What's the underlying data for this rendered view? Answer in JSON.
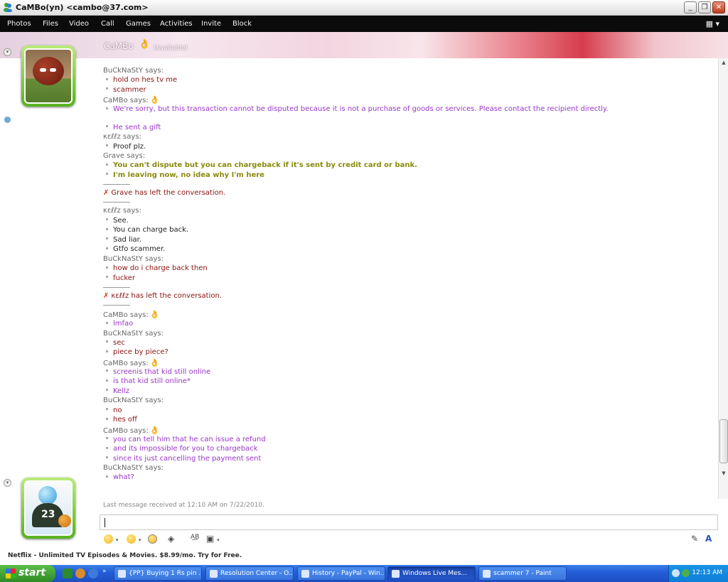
{
  "window": {
    "title": "CaMBo(yn) <cambo@37.com>"
  },
  "menu": [
    "Photos",
    "Files",
    "Video",
    "Call",
    "Games",
    "Activities",
    "Invite",
    "Block"
  ],
  "banner": {
    "name": "CaMBo",
    "status": "(Available)"
  },
  "conversation": [
    {
      "kind": "says",
      "who": "BuCkNaStY",
      "text": "BuCkNaStY says:"
    },
    {
      "kind": "msg",
      "cls": "c-buck",
      "text": "hold on hes tv me"
    },
    {
      "kind": "msg",
      "cls": "c-buck",
      "text": "scammer"
    },
    {
      "kind": "says",
      "who": "CaMBo",
      "text": "CaMBo says:",
      "hand": true
    },
    {
      "kind": "msg",
      "cls": "c-cambo",
      "text": "We're sorry, but this transaction cannot be disputed because it is not a purchase of goods or services. Please contact the recipient directly."
    },
    {
      "kind": "msg",
      "cls": "c-cambo",
      "text": "He sent a gift",
      "gap": true
    },
    {
      "kind": "says",
      "who": "κεℓℓz",
      "text": "κεℓℓz says:"
    },
    {
      "kind": "msg",
      "cls": "c-kellz",
      "text": "Proof plz."
    },
    {
      "kind": "says",
      "who": "Grave",
      "text": "Grave says:"
    },
    {
      "kind": "msg",
      "cls": "c-grave",
      "text": "You can't dispute but you can chargeback if it's sent by credit card or bank."
    },
    {
      "kind": "msg",
      "cls": "c-grave",
      "text": "I'm leaving now, no idea why I'm here"
    },
    {
      "kind": "hr"
    },
    {
      "kind": "sys",
      "text": "Grave has left the conversation."
    },
    {
      "kind": "hr"
    },
    {
      "kind": "says",
      "who": "κεℓℓz",
      "text": "κεℓℓz says:"
    },
    {
      "kind": "msg",
      "cls": "c-kellz",
      "text": "See."
    },
    {
      "kind": "msg",
      "cls": "c-kellz",
      "text": "You can charge back."
    },
    {
      "kind": "msg",
      "cls": "c-kellz",
      "text": "Sad liar."
    },
    {
      "kind": "msg",
      "cls": "c-kellz",
      "text": "Gtfo scammer."
    },
    {
      "kind": "says",
      "who": "BuCkNaStY",
      "text": "BuCkNaStY says:"
    },
    {
      "kind": "msg",
      "cls": "c-buck",
      "text": "how do i charge back then"
    },
    {
      "kind": "msg",
      "cls": "c-buck",
      "text": "fucker"
    },
    {
      "kind": "hr"
    },
    {
      "kind": "sys",
      "text": "κεℓℓz has left the conversation."
    },
    {
      "kind": "hr"
    },
    {
      "kind": "says",
      "who": "CaMBo",
      "text": "CaMBo says:",
      "hand": true
    },
    {
      "kind": "msg",
      "cls": "c-cambo",
      "text": "lmfao"
    },
    {
      "kind": "says",
      "who": "BuCkNaStY",
      "text": "BuCkNaStY says:"
    },
    {
      "kind": "msg",
      "cls": "c-buck",
      "text": "sec"
    },
    {
      "kind": "msg",
      "cls": "c-buck",
      "text": "piece by piece?"
    },
    {
      "kind": "says",
      "who": "CaMBo",
      "text": "CaMBo says:",
      "hand": true
    },
    {
      "kind": "msg",
      "cls": "c-cambo",
      "text": "screenis that kid still online"
    },
    {
      "kind": "msg",
      "cls": "c-cambo",
      "text": "is that kid still online*"
    },
    {
      "kind": "msg",
      "cls": "c-cambo",
      "text": "Kellz"
    },
    {
      "kind": "says",
      "who": "BuCkNaStY",
      "text": "BuCkNaStY says:"
    },
    {
      "kind": "msg",
      "cls": "c-buck",
      "text": "no"
    },
    {
      "kind": "msg",
      "cls": "c-buck",
      "text": "hes off"
    },
    {
      "kind": "says",
      "who": "CaMBo",
      "text": "CaMBo says:",
      "hand": true
    },
    {
      "kind": "msg",
      "cls": "c-cambo",
      "text": "you can tell him that he can issue a refund"
    },
    {
      "kind": "msg",
      "cls": "c-cambo",
      "text": "and its impossible for you to chargeback"
    },
    {
      "kind": "msg",
      "cls": "c-cambo",
      "text": "since its just cancelling the payment sent"
    },
    {
      "kind": "says",
      "who": "BuCkNaStY",
      "text": "BuCkNaStY says:"
    },
    {
      "kind": "msg",
      "cls": "c-cambo",
      "text": "what?"
    }
  ],
  "last_message": "Last message received at 12:10 AM on 7/22/2010.",
  "ad": "Netflix - Unlimited TV Episodes & Movies. $8.99/mo. Try for Free.",
  "taskbar": {
    "start": "start",
    "tasks": [
      {
        "label": "{PP} Buying 1 Rs pin ...",
        "active": false
      },
      {
        "label": "Resolution Center - O...",
        "active": false
      },
      {
        "label": "History - PayPal - Win...",
        "active": false
      },
      {
        "label": "Windows Live Mes...",
        "active": true
      },
      {
        "label": "scammer 7 - Paint",
        "active": false
      }
    ],
    "clock": "12:13 AM"
  },
  "colors": {
    "menubar": "#0b0b0b",
    "taskbar": "#245edb",
    "start": "#2f8b24"
  }
}
